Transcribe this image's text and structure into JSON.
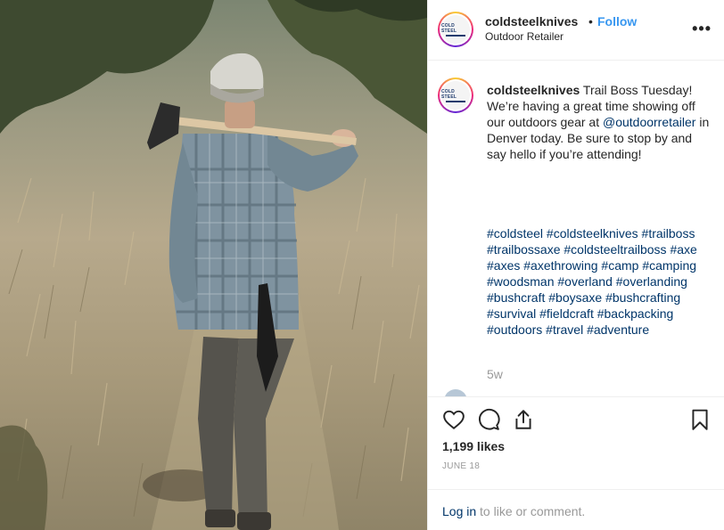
{
  "post": {
    "username": "coldsteelknives",
    "separator": "•",
    "follow_label": "Follow",
    "location": "Outdoor Retailer",
    "more_label": "•••",
    "logo_text": "COLD STEEL"
  },
  "caption": {
    "username": "coldsteelknives",
    "text_before_mention": " Trail Boss Tuesday! We’re having a great time showing off our outdoors gear at ",
    "mention": "@outdoorretailer",
    "text_after_mention": " in Denver today. Be sure to stop by and say hello if you’re attending!",
    "hashtags": "#coldsteel #coldsteelknives #trailboss #trailbossaxe #coldsteeltrailboss #axe #axes #axethrowing #camp #camping #woodsman #overland #overlanding #bushcraft #boysaxe #bushcrafting #survival #fieldcraft #backpacking #outdoors #travel #adventure",
    "age": "5w"
  },
  "engagement": {
    "likes": "1,199 likes",
    "date": "JUNE 18"
  },
  "footer": {
    "login_link": "Log in",
    "login_rest": " to like or comment."
  },
  "colors": {
    "link": "#3897f0",
    "hashtag": "#003569",
    "muted": "#999999"
  },
  "icons": [
    "heart-icon",
    "comment-icon",
    "share-icon",
    "bookmark-icon",
    "more-options-icon"
  ]
}
